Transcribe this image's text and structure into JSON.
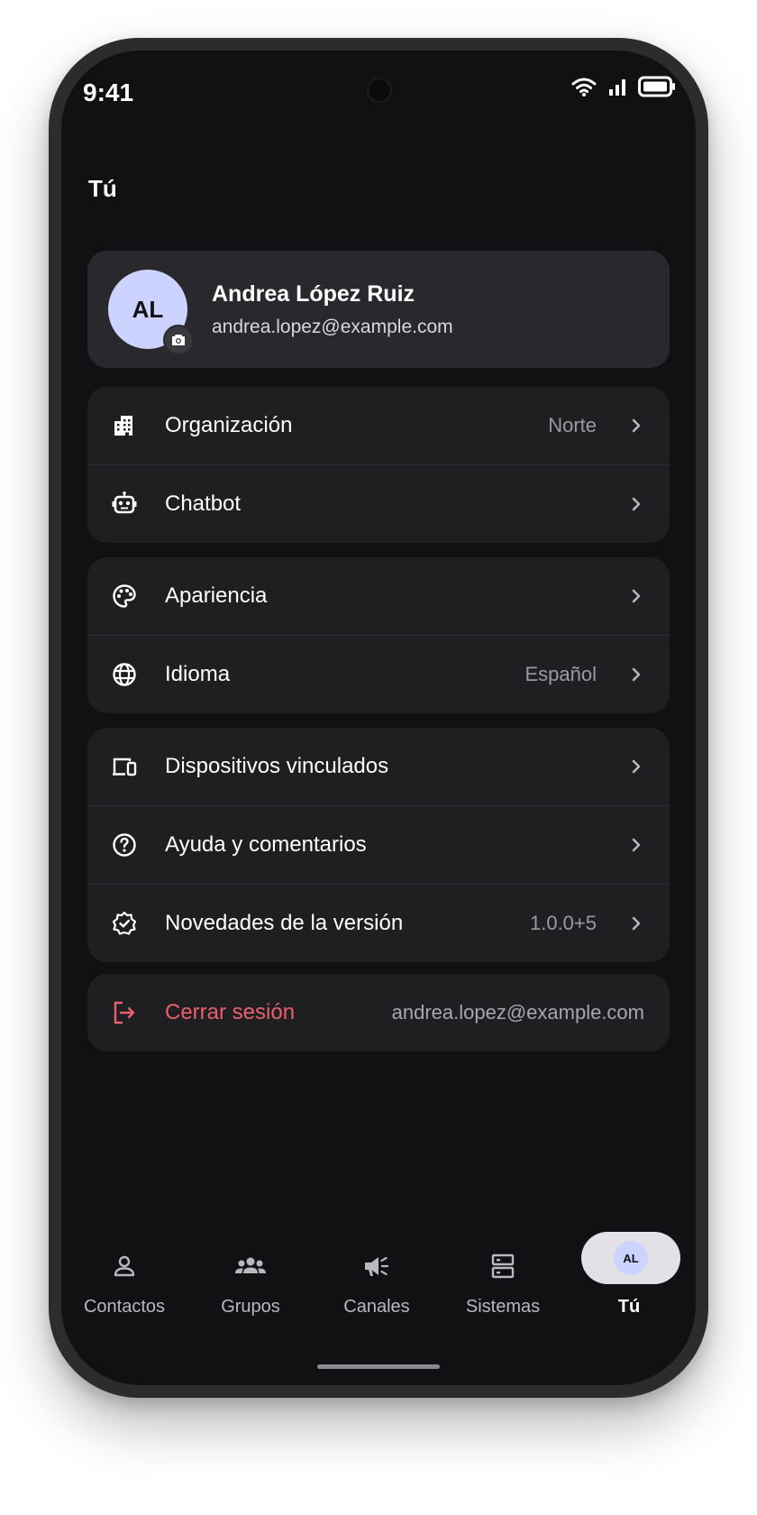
{
  "status_bar": {
    "time": "9:41"
  },
  "page": {
    "title": "Tú"
  },
  "profile": {
    "initials": "AL",
    "name": "Andrea López Ruiz",
    "email": "andrea.lopez@example.com"
  },
  "groups": {
    "workspace": [
      {
        "icon": "building-icon",
        "label": "Organización",
        "value": "Norte"
      },
      {
        "icon": "robot-icon",
        "label": "Chatbot",
        "value": ""
      }
    ],
    "preferences": [
      {
        "icon": "palette-icon",
        "label": "Apariencia",
        "value": ""
      },
      {
        "icon": "globe-icon",
        "label": "Idioma",
        "value": "Español"
      }
    ],
    "support": [
      {
        "icon": "devices-icon",
        "label": "Dispositivos vinculados",
        "value": ""
      },
      {
        "icon": "help-circle-icon",
        "label": "Ayuda y comentarios",
        "value": ""
      },
      {
        "icon": "verified-badge-icon",
        "label": "Novedades de la versión",
        "value": "1.0.0+5"
      }
    ]
  },
  "logout": {
    "icon": "logout-icon",
    "label": "Cerrar sesión",
    "email": "andrea.lopez@example.com",
    "color": "#e8606e"
  },
  "bottom_nav": [
    {
      "icon": "person-icon",
      "label": "Contactos",
      "active": false
    },
    {
      "icon": "groups-icon",
      "label": "Grupos",
      "active": false
    },
    {
      "icon": "megaphone-icon",
      "label": "Canales",
      "active": false
    },
    {
      "icon": "server-icon",
      "label": "Sistemas",
      "active": false
    },
    {
      "icon": "avatar",
      "label": "Tú",
      "initials": "AL",
      "active": true
    }
  ],
  "colors": {
    "background": "#111113",
    "card": "#1f1f22",
    "profile_card": "#29292d",
    "avatar": "#cdd3ff",
    "danger": "#e8606e"
  }
}
